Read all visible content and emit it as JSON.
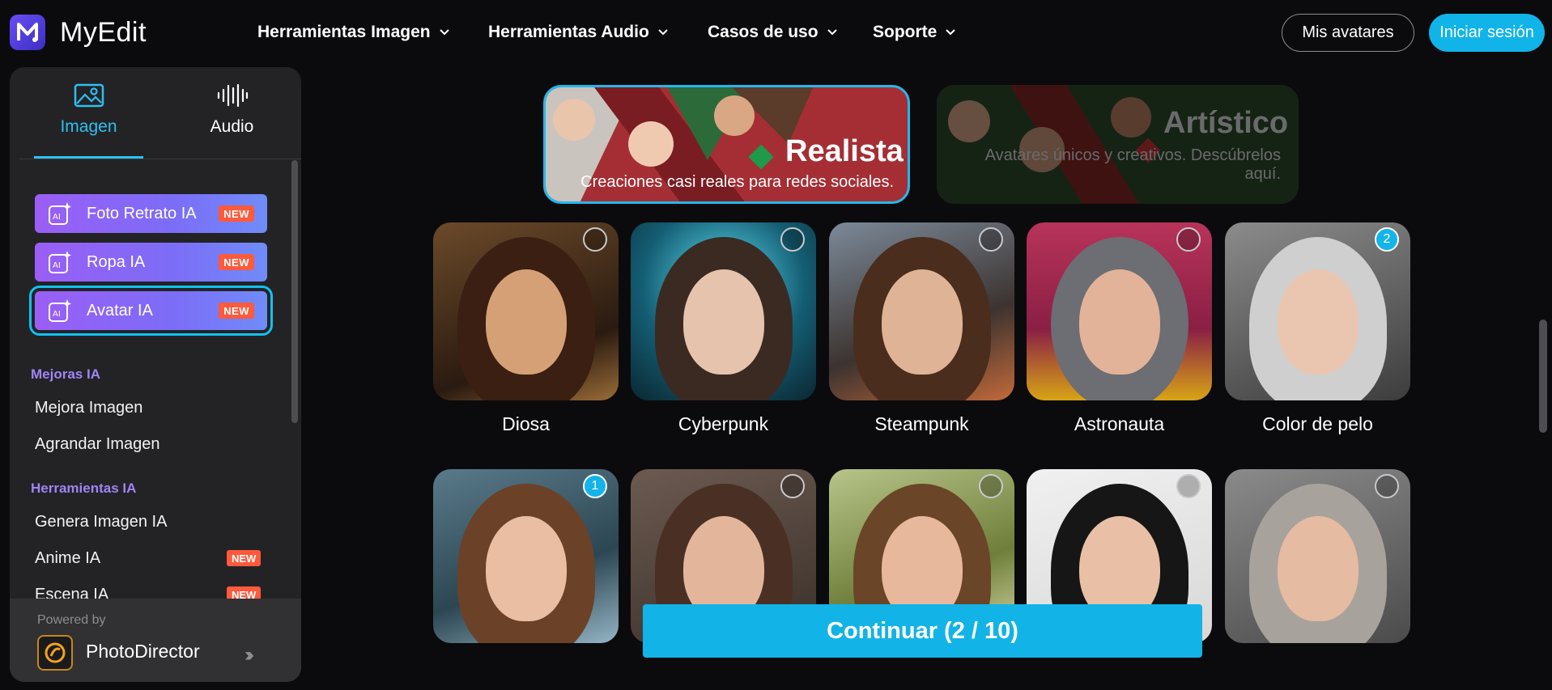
{
  "header": {
    "brand": "MyEdit",
    "nav": [
      {
        "label": "Herramientas Imagen"
      },
      {
        "label": "Herramientas Audio"
      },
      {
        "label": "Casos de uso"
      },
      {
        "label": "Soporte"
      }
    ],
    "avatars_button": "Mis avatares",
    "login_button": "Iniciar sesión"
  },
  "sidebar": {
    "tabs": [
      {
        "label": "Imagen",
        "active": true,
        "icon": "image-icon"
      },
      {
        "label": "Audio",
        "active": false,
        "icon": "waveform-icon"
      }
    ],
    "featured": [
      {
        "label": "Foto Retrato IA",
        "badge": "NEW"
      },
      {
        "label": "Ropa IA",
        "badge": "NEW"
      },
      {
        "label": "Avatar IA",
        "badge": "NEW",
        "selected": true
      }
    ],
    "sections": [
      {
        "title": "Mejoras IA",
        "items": [
          {
            "label": "Mejora Imagen"
          },
          {
            "label": "Agrandar Imagen"
          }
        ]
      },
      {
        "title": "Herramientas IA",
        "items": [
          {
            "label": "Genera Imagen IA"
          },
          {
            "label": "Anime IA",
            "badge": "NEW"
          },
          {
            "label": "Escena IA",
            "badge": "NEW"
          }
        ]
      }
    ],
    "powered_by": "Powered by",
    "partner": "PhotoDirector"
  },
  "banners": [
    {
      "title": "Realista",
      "subtitle": "Creaciones casi reales para redes sociales.",
      "selected": true
    },
    {
      "title": "Artístico",
      "subtitle": "Avatares únicos y creativos. Descúbrelos aquí.",
      "selected": false
    }
  ],
  "styles": [
    {
      "label": "Diosa",
      "selection": ""
    },
    {
      "label": "Cyberpunk",
      "selection": ""
    },
    {
      "label": "Steampunk",
      "selection": ""
    },
    {
      "label": "Astronauta",
      "selection": ""
    },
    {
      "label": "Color de pelo",
      "selection": "2"
    },
    {
      "label": "",
      "selection": "1"
    },
    {
      "label": "",
      "selection": ""
    },
    {
      "label": "",
      "selection": ""
    },
    {
      "label": "",
      "selection": ""
    },
    {
      "label": "",
      "selection": ""
    }
  ],
  "continue_button": "Continuar (2 / 10)",
  "colors": {
    "accent": "#12b3e6",
    "new_badge": "#ff5a3c",
    "section_head": "#9f85f5"
  }
}
